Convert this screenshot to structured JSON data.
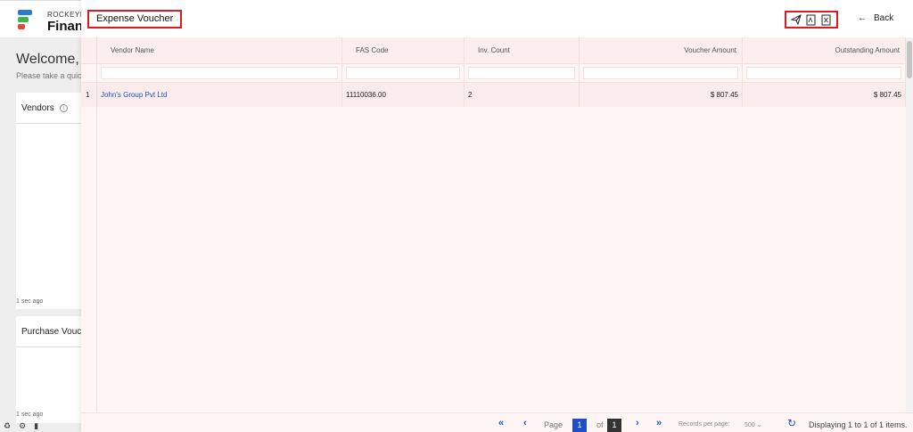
{
  "background": {
    "brand_top": "ROCKEYI",
    "brand_main": "Financ",
    "welcome": "Welcome, Jo",
    "welcome_sub": "Please take a quick",
    "cards": [
      {
        "title": "Vendors",
        "time": "1 sec ago"
      },
      {
        "title": "Purchase Vouch",
        "time": "1 sec ago"
      }
    ]
  },
  "modal": {
    "title": "Expense Voucher",
    "actions": [
      {
        "name": "send-icon"
      },
      {
        "name": "pdf-icon"
      },
      {
        "name": "excel-icon"
      }
    ],
    "back_label": "Back"
  },
  "table": {
    "columns": [
      "Vendor Name",
      "FAS Code",
      "Inv. Count",
      "Voucher Amount",
      "Outstanding Amount"
    ],
    "rows": [
      {
        "index": "1",
        "vendor": "John's Group Pvt Ltd",
        "fas_code": "11110036.00",
        "inv_count": "2",
        "voucher_amount": "$ 807.45",
        "outstanding_amount": "$ 807.45"
      }
    ]
  },
  "pager": {
    "page_label": "Page",
    "current_page": "1",
    "of_label": "of",
    "total_pages": "1",
    "records_label": "Records per page:",
    "records_value": "500",
    "display_text": "Displaying 1 to 1 of 1 items."
  },
  "colors": {
    "accent": "#1f4fc4",
    "highlight": "#e0191f",
    "row_bg": "#f9eceb"
  }
}
